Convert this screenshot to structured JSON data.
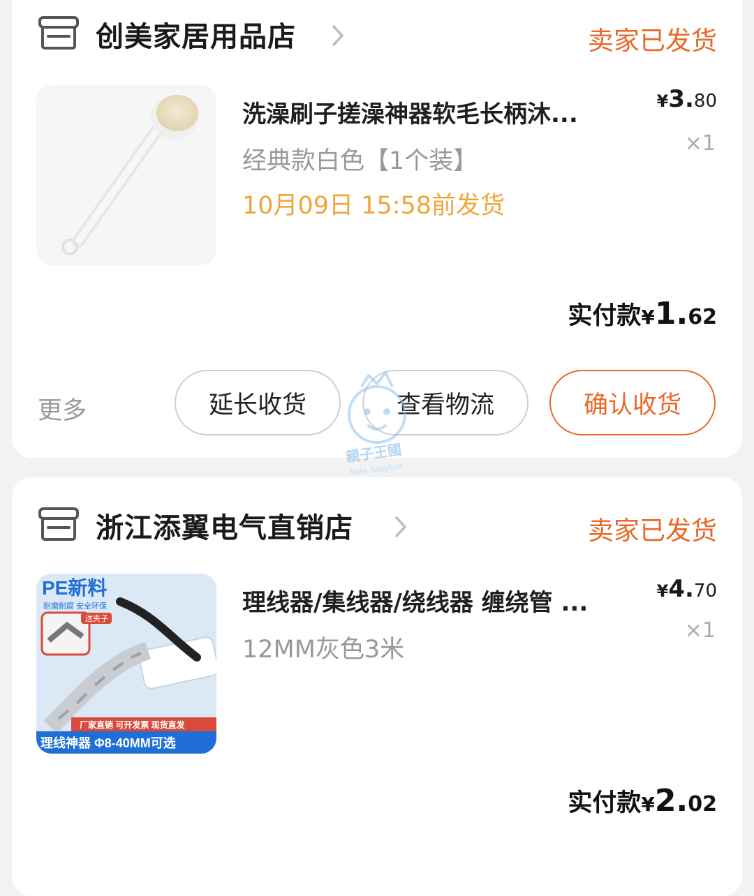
{
  "orders": [
    {
      "store_name": "创美家居用品店",
      "status": "卖家已发货",
      "product": {
        "title": "洗澡刷子搓澡神器软毛长柄沐...",
        "variant": "经典款白色【1个装】",
        "ship_notice": "10月09日 15:58前发货",
        "price_currency": "¥",
        "price_int": "3.",
        "price_dec": "80",
        "quantity": "×1",
        "image_icon": "bath-brush-image"
      },
      "paid": {
        "label": "实付款",
        "currency": "¥",
        "int": "1.",
        "dec": "62"
      },
      "actions": {
        "more": "更多",
        "extend": "延长收货",
        "logistics": "查看物流",
        "confirm": "确认收货"
      }
    },
    {
      "store_name": "浙江添翼电气直销店",
      "status": "卖家已发货",
      "product": {
        "title": "理线器/集线器/绕线器 缠绕管 ...",
        "variant": "12MM灰色3米",
        "price_currency": "¥",
        "price_int": "4.",
        "price_dec": "70",
        "quantity": "×1",
        "image_icon": "cable-organizer-image",
        "image_text": {
          "headline": "PE新料",
          "sub": "耐磨耐腐 安全环保",
          "badge": "送夹子",
          "banner1": "厂家直销 可开发票 现货直发",
          "banner2": "理线神器 Φ8-40MM可选"
        }
      },
      "paid": {
        "label": "实付款",
        "currency": "¥",
        "int": "2.",
        "dec": "02"
      }
    }
  ],
  "watermark": {
    "line1": "親子王國",
    "line2": "Baby Kingdom"
  },
  "colors": {
    "accent": "#e8692a",
    "ship_notice": "#f0a53a",
    "muted": "#999999",
    "background": "#f2f2f2"
  }
}
